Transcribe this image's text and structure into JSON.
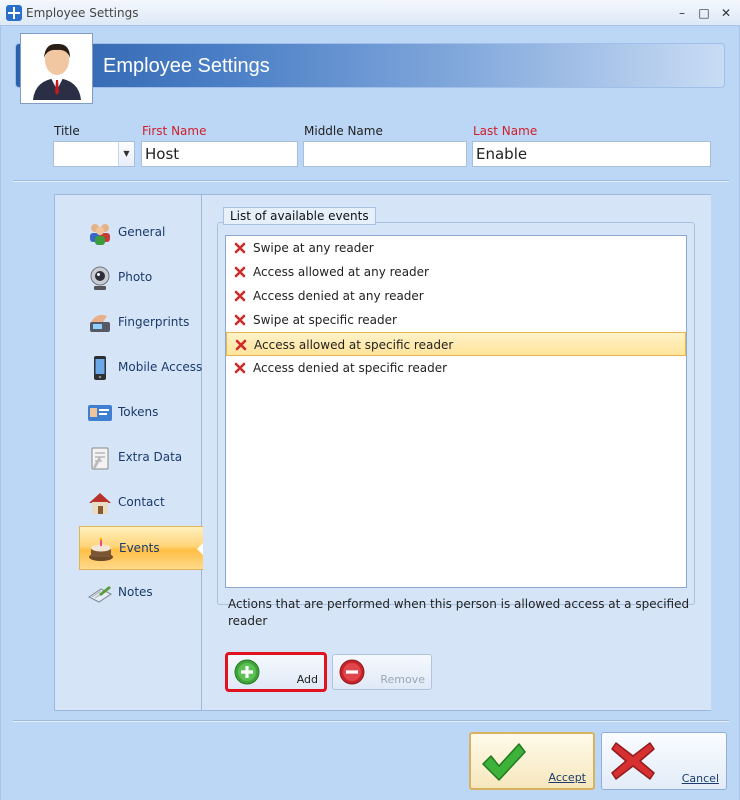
{
  "window": {
    "title": "Employee Settings",
    "controls": {
      "minimize": "–",
      "maximize": "□",
      "close": "✕"
    }
  },
  "header": {
    "title": "Employee Settings",
    "avatar_icon": "businessman-avatar-icon"
  },
  "fields": {
    "title": {
      "label": "Title",
      "value": ""
    },
    "first_name": {
      "label": "First Name",
      "value": "Host"
    },
    "middle_name": {
      "label": "Middle Name",
      "value": ""
    },
    "last_name": {
      "label": "Last Name",
      "value": "Enable"
    }
  },
  "nav": {
    "items": [
      {
        "label": "General",
        "icon": "people-icon"
      },
      {
        "label": "Photo",
        "icon": "webcam-icon"
      },
      {
        "label": "Fingerprints",
        "icon": "fingerprint-icon"
      },
      {
        "label": "Mobile Access",
        "icon": "mobile-phone-icon"
      },
      {
        "label": "Tokens",
        "icon": "id-card-icon"
      },
      {
        "label": "Extra Data",
        "icon": "clipboard-icon"
      },
      {
        "label": "Contact",
        "icon": "house-icon"
      },
      {
        "label": "Events",
        "icon": "cake-icon",
        "active": true
      },
      {
        "label": "Notes",
        "icon": "notebook-icon"
      }
    ]
  },
  "events": {
    "group_title": "List of available events",
    "items": [
      "Swipe at any reader",
      "Access allowed at any reader",
      "Access denied at any reader",
      "Swipe at specific reader",
      "Access allowed at specific reader",
      "Access denied at specific reader"
    ],
    "selected_index": 4,
    "description": "Actions that are performed when this person is allowed access at a specified reader"
  },
  "actions": {
    "add_label": "Add",
    "remove_label": "Remove"
  },
  "footer": {
    "accept_label": "Accept",
    "cancel_label": "Cancel"
  },
  "colors": {
    "accent": "#2c62ad",
    "required_label": "#d0202a",
    "highlight": "#ffd57a",
    "add_border": "#e0131f"
  }
}
